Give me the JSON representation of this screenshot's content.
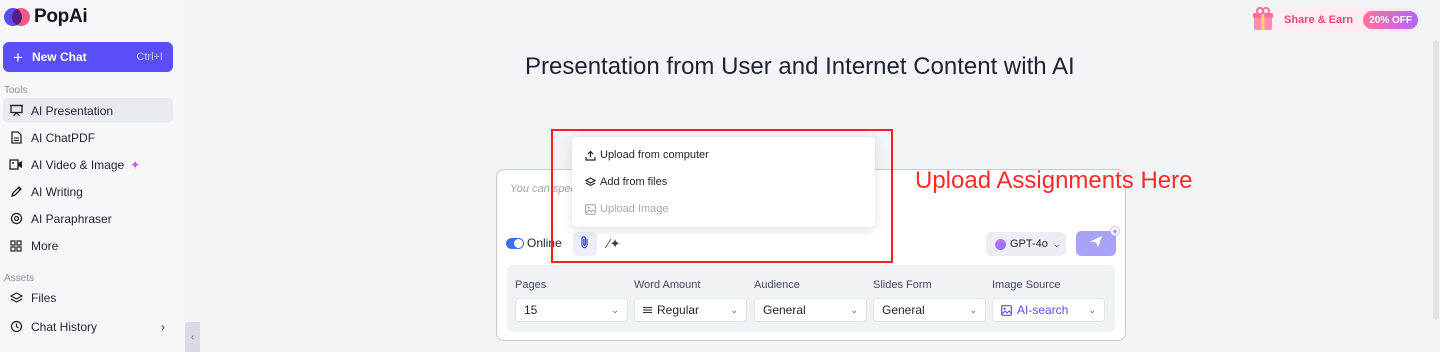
{
  "app": {
    "name": "PopAi"
  },
  "sidebar": {
    "new_chat": {
      "label": "New Chat",
      "shortcut": "Ctrl+I"
    },
    "tools_label": "Tools",
    "tools": [
      {
        "label": "AI Presentation",
        "icon": "presentation-icon",
        "active": true
      },
      {
        "label": "AI ChatPDF",
        "icon": "document-icon"
      },
      {
        "label": "AI Video & Image",
        "icon": "media-icon"
      },
      {
        "label": "AI Writing",
        "icon": "pen-icon"
      },
      {
        "label": "AI Paraphraser",
        "icon": "paraphrase-icon"
      },
      {
        "label": "More",
        "icon": "grid-icon"
      }
    ],
    "assets_label": "Assets",
    "assets": [
      {
        "label": "Files",
        "icon": "layers-icon"
      },
      {
        "label": "Chat History",
        "icon": "history-icon"
      }
    ]
  },
  "promo": {
    "label": "Share & Earn",
    "badge": "20% OFF"
  },
  "main": {
    "title": "Presentation from User and Internet Content with AI",
    "composer": {
      "placeholder": "You can specif",
      "online_label": "Online",
      "online_enabled": true,
      "model": "GPT-4o"
    },
    "upload_menu": {
      "items": [
        {
          "label": "Upload from computer",
          "icon": "upload-icon",
          "enabled": true
        },
        {
          "label": "Add from files",
          "icon": "layers-icon",
          "enabled": true
        },
        {
          "label": "Upload Image",
          "icon": "image-icon",
          "enabled": false
        }
      ]
    },
    "options": [
      {
        "label": "Pages",
        "value": "15"
      },
      {
        "label": "Word Amount",
        "value": "Regular"
      },
      {
        "label": "Audience",
        "value": "General"
      },
      {
        "label": "Slides Form",
        "value": "General"
      },
      {
        "label": "Image Source",
        "value": "AI-search"
      }
    ]
  },
  "annotation": {
    "text": "Upload Assignments Here",
    "color": "#ff2a2a"
  },
  "colors": {
    "accent": "#5a4ff7",
    "send_button": "#a9a3f7",
    "toggle": "#3b6ef5"
  }
}
